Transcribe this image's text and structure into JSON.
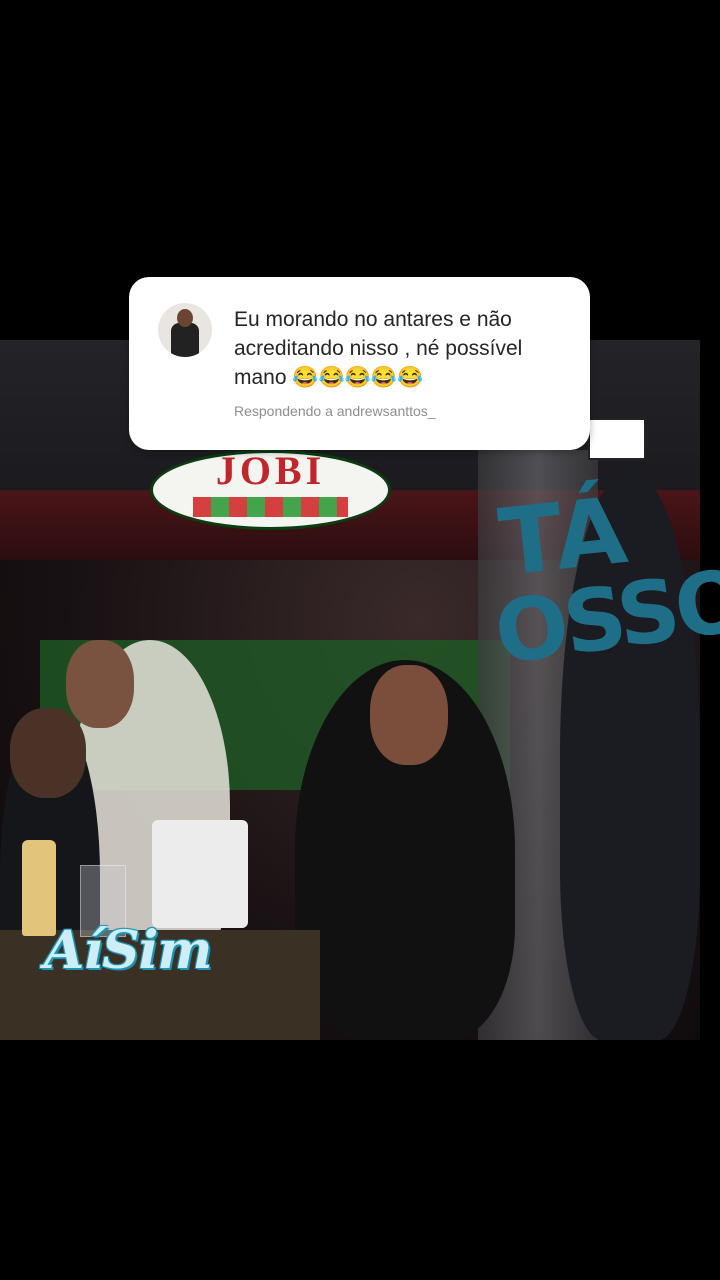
{
  "reply": {
    "comment": "Eu morando no antares e não acreditando nisso , né possível mano 😂😂😂😂😂",
    "subtitle": "Respondendo a andrewsanttos_"
  },
  "photo": {
    "sign_text": "JOBI"
  },
  "stickers": {
    "ta": "TÁ",
    "osso": "OSSO",
    "ai_sim": "AíSim"
  }
}
